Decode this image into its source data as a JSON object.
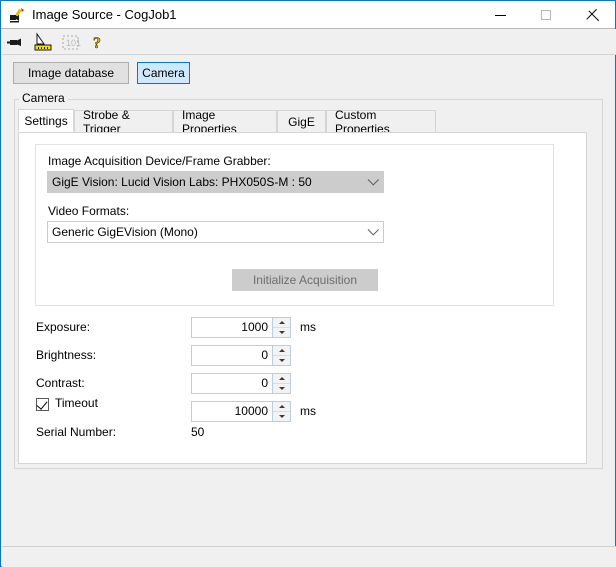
{
  "window": {
    "title": "Image Source - CogJob1",
    "icon": "camera-job-icon",
    "controls": {
      "minimize": "minimize-icon",
      "maximize": "maximize-icon",
      "close": "close-icon"
    }
  },
  "toolbar": {
    "items": [
      {
        "name": "camera-icon",
        "tooltip": "Camera"
      },
      {
        "name": "calibration-ruler-icon",
        "tooltip": "Calibration"
      },
      {
        "name": "region-select-icon",
        "tooltip": "Region"
      },
      {
        "name": "help-icon",
        "tooltip": "Help"
      }
    ]
  },
  "modebar": {
    "image_database_label": "Image database",
    "camera_label": "Camera",
    "selected": "Camera"
  },
  "group": {
    "label": "Camera"
  },
  "tabs": [
    {
      "label": "Settings",
      "active": true
    },
    {
      "label": "Strobe & Trigger",
      "active": false
    },
    {
      "label": "Image Properties",
      "active": false
    },
    {
      "label": "GigE",
      "active": false
    },
    {
      "label": "Custom Properties",
      "active": false
    }
  ],
  "settings": {
    "device_label": "Image Acquisition Device/Frame Grabber:",
    "device_value": "GigE Vision: Lucid Vision Labs: PHX050S-M : 50",
    "format_label": "Video Formats:",
    "format_value": "Generic GigEVision (Mono)",
    "initialize_button": "Initialize Acquisition",
    "initialize_enabled": false,
    "fields": [
      {
        "label": "Exposure:",
        "value": "1000",
        "unit": "ms"
      },
      {
        "label": "Brightness:",
        "value": "0",
        "unit": ""
      },
      {
        "label": "Contrast:",
        "value": "0",
        "unit": ""
      }
    ],
    "timeout": {
      "label": "Timeout",
      "checked": true,
      "value": "10000",
      "unit": "ms"
    },
    "serial": {
      "label": "Serial Number:",
      "value": "50"
    }
  },
  "colors": {
    "accent": "#0078d7",
    "window_bg": "#f0f0f0",
    "panel_bg": "#ffffff",
    "disabled_bg": "#cccccc",
    "disabled_text": "#6d6d6d"
  }
}
